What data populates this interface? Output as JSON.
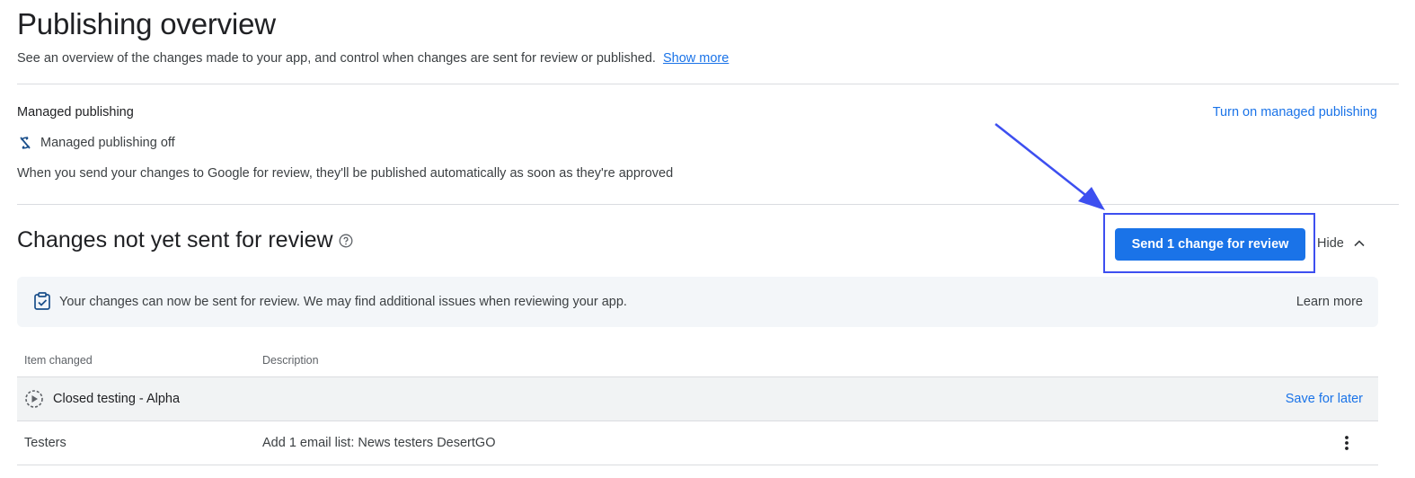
{
  "header": {
    "title": "Publishing overview",
    "subtitle": "See an overview of the changes made to your app, and control when changes are sent for review or published.",
    "show_more": "Show more"
  },
  "managed_publishing": {
    "title": "Managed publishing",
    "turn_on_link": "Turn on managed publishing",
    "status": "Managed publishing off",
    "status_icon": "sync-disabled-icon",
    "description": "When you send your changes to Google for review, they'll be published automatically as soon as they're approved"
  },
  "changes_section": {
    "title": "Changes not yet sent for review",
    "help_icon": "help-icon",
    "send_button": "Send 1 change for review",
    "hide_button": "Hide",
    "banner_icon": "clipboard-check-icon",
    "banner_text": "Your changes can now be sent for review. We may find additional issues when reviewing your app.",
    "banner_link": "Learn more"
  },
  "table": {
    "columns": [
      "Item changed",
      "Description"
    ],
    "groups": [
      {
        "label": "Closed testing - Alpha",
        "icon": "play-circle-icon",
        "action": "Save for later",
        "rows": [
          {
            "item": "Testers",
            "description": "Add 1 email list: News testers DesertGO"
          }
        ]
      }
    ]
  },
  "colors": {
    "accent": "#1a73e8",
    "annotation": "#3d4ff0",
    "banner_bg": "#f3f6f9",
    "group_bg": "#f1f3f4"
  }
}
